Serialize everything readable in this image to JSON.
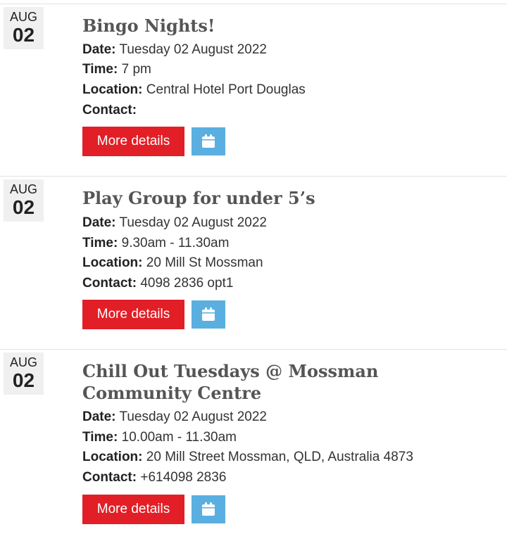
{
  "events": [
    {
      "month": "AUG",
      "day": "02",
      "title": "Bingo Nights!",
      "date_label": "Date:",
      "date": "Tuesday 02 August 2022",
      "time_label": "Time:",
      "time": "7 pm",
      "location_label": "Location:",
      "location": "Central Hotel Port Douglas",
      "contact_label": "Contact:",
      "contact": "",
      "more_label": "More details",
      "calendar_icon": "calendar-icon"
    },
    {
      "month": "AUG",
      "day": "02",
      "title": "Play Group for under 5’s",
      "date_label": "Date:",
      "date": "Tuesday 02 August 2022",
      "time_label": "Time:",
      "time": "9.30am - 11.30am",
      "location_label": "Location:",
      "location": "20 Mill St Mossman",
      "contact_label": "Contact:",
      "contact": "4098 2836 opt1",
      "more_label": "More details",
      "calendar_icon": "calendar-icon"
    },
    {
      "month": "AUG",
      "day": "02",
      "title": "Chill Out Tuesdays @ Mossman Community Centre",
      "date_label": "Date:",
      "date": "Tuesday 02 August 2022",
      "time_label": "Time:",
      "time": "10.00am - 11.30am",
      "location_label": "Location:",
      "location": "20 Mill Street Mossman, QLD, Australia 4873",
      "contact_label": "Contact:",
      "contact": "+614098 2836",
      "more_label": "More details",
      "calendar_icon": "calendar-icon"
    }
  ],
  "colors": {
    "button_red": "#e21e26",
    "calendar_blue": "#5aafe0",
    "title_gray": "#555555"
  }
}
